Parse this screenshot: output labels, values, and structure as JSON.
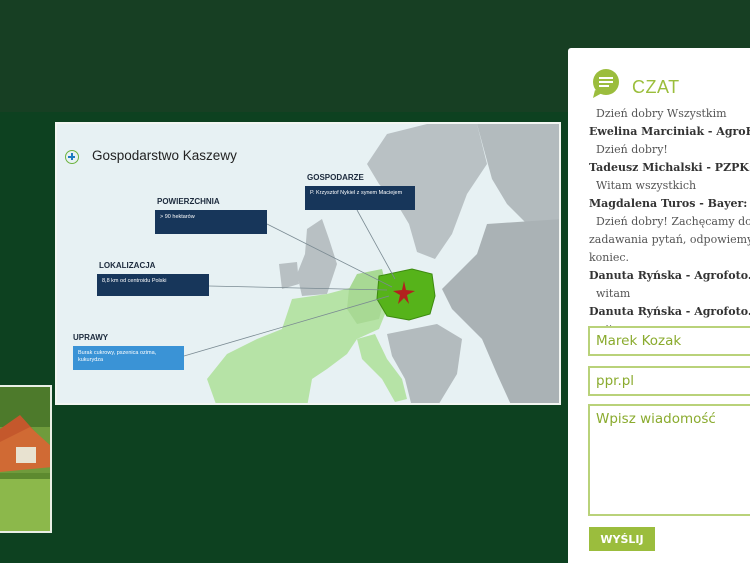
{
  "slide": {
    "title": "Gospodarstwo Kaszewy",
    "sections": [
      {
        "label": "POWIERZCHNIA",
        "text": "> 90 hektarów"
      },
      {
        "label": "LOKALIZACJA",
        "text": "8,8 km od centroidu Polski"
      },
      {
        "label": "UPRAWY",
        "text": "Burak cukrowy, pszenica ozima, kukurydza"
      },
      {
        "label": "GOSPODARZE",
        "text": "P. Krzysztof Nykiel z synem Maciejem"
      }
    ]
  },
  "chat": {
    "title": "CZAT",
    "messages": [
      {
        "author": "",
        "text": "Dzień dobry Wszystkim"
      },
      {
        "author": "Ewelina Marciniak - AgroFakt.pl:",
        "text": "Dzień dobry!"
      },
      {
        "author": "Tadeusz Michalski - PZPK:",
        "text": "Witam wszystkich"
      },
      {
        "author": "Magdalena Turos - Bayer:",
        "text": "Dzień dobry! Zachęcamy do zadawania pytań, odpowiemy na koniec."
      },
      {
        "author": "Danuta Ryńska - Agrofoto.pl:",
        "text": "witam"
      },
      {
        "author": "Danuta Ryńska - Agrofoto.pl:",
        "text": "witam"
      }
    ],
    "name_value": "Marek Kozak",
    "site_value": "ppr.pl",
    "message_placeholder": "Wpisz wiadomość",
    "send_label": "WYŚLIJ"
  },
  "colors": {
    "accent": "#9bbd3d",
    "background": "#0d4120",
    "topbar": "#173f23"
  }
}
